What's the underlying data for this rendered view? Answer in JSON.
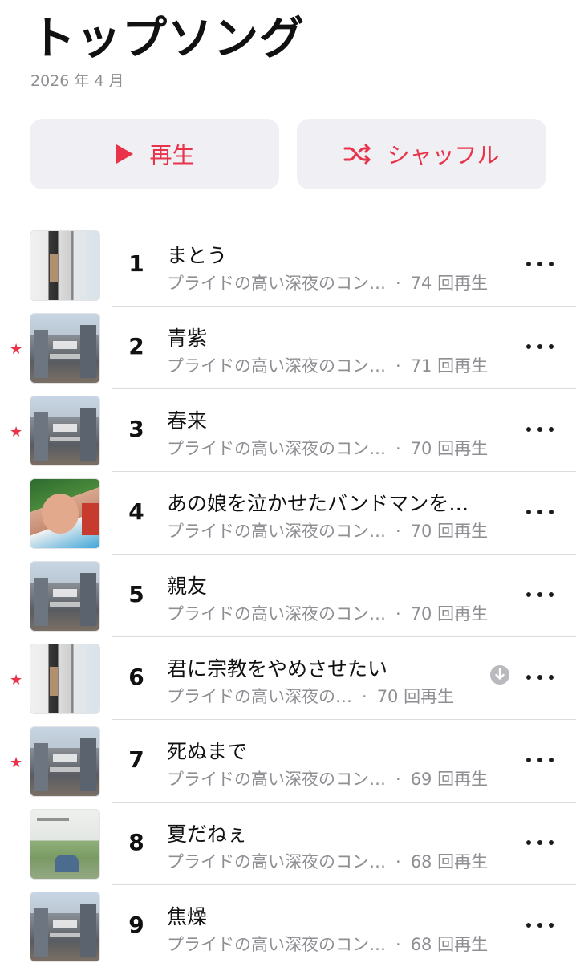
{
  "header": {
    "title": "トップソング",
    "subtitle": "2026 年 4 月"
  },
  "actions": {
    "play_label": "再生",
    "shuffle_label": "シャッフル"
  },
  "colors": {
    "accent": "#e8334a",
    "secondary_text": "#8e8e93",
    "button_bg": "#efeff4"
  },
  "songs": [
    {
      "rank": "1",
      "title": "まとう",
      "album": "プライドの高い深夜のコン…",
      "plays": "74 回再生",
      "favorite": false,
      "downloaded": false,
      "art": "a"
    },
    {
      "rank": "2",
      "title": "青紫",
      "album": "プライドの高い深夜のコン…",
      "plays": "71 回再生",
      "favorite": true,
      "downloaded": false,
      "art": "b"
    },
    {
      "rank": "3",
      "title": "春来",
      "album": "プライドの高い深夜のコン…",
      "plays": "70 回再生",
      "favorite": true,
      "downloaded": false,
      "art": "b"
    },
    {
      "rank": "4",
      "title": "あの娘を泣かせたバンドマンを…",
      "album": "プライドの高い深夜のコン…",
      "plays": "70 回再生",
      "favorite": false,
      "downloaded": false,
      "art": "c"
    },
    {
      "rank": "5",
      "title": "親友",
      "album": "プライドの高い深夜のコン…",
      "plays": "70 回再生",
      "favorite": false,
      "downloaded": false,
      "art": "b"
    },
    {
      "rank": "6",
      "title": "君に宗教をやめさせたい",
      "album": "プライドの高い深夜の…",
      "plays": "70 回再生",
      "favorite": true,
      "downloaded": true,
      "art": "a"
    },
    {
      "rank": "7",
      "title": "死ぬまで",
      "album": "プライドの高い深夜のコン…",
      "plays": "69 回再生",
      "favorite": true,
      "downloaded": false,
      "art": "b"
    },
    {
      "rank": "8",
      "title": "夏だねぇ",
      "album": "プライドの高い深夜のコン…",
      "plays": "68 回再生",
      "favorite": false,
      "downloaded": false,
      "art": "d"
    },
    {
      "rank": "9",
      "title": "焦燥",
      "album": "プライドの高い深夜のコン…",
      "plays": "68 回再生",
      "favorite": false,
      "downloaded": false,
      "art": "b"
    }
  ],
  "icons": {
    "favorite": "star-icon",
    "download": "download-icon",
    "more": "more-icon",
    "play": "play-icon",
    "shuffle": "shuffle-icon"
  }
}
